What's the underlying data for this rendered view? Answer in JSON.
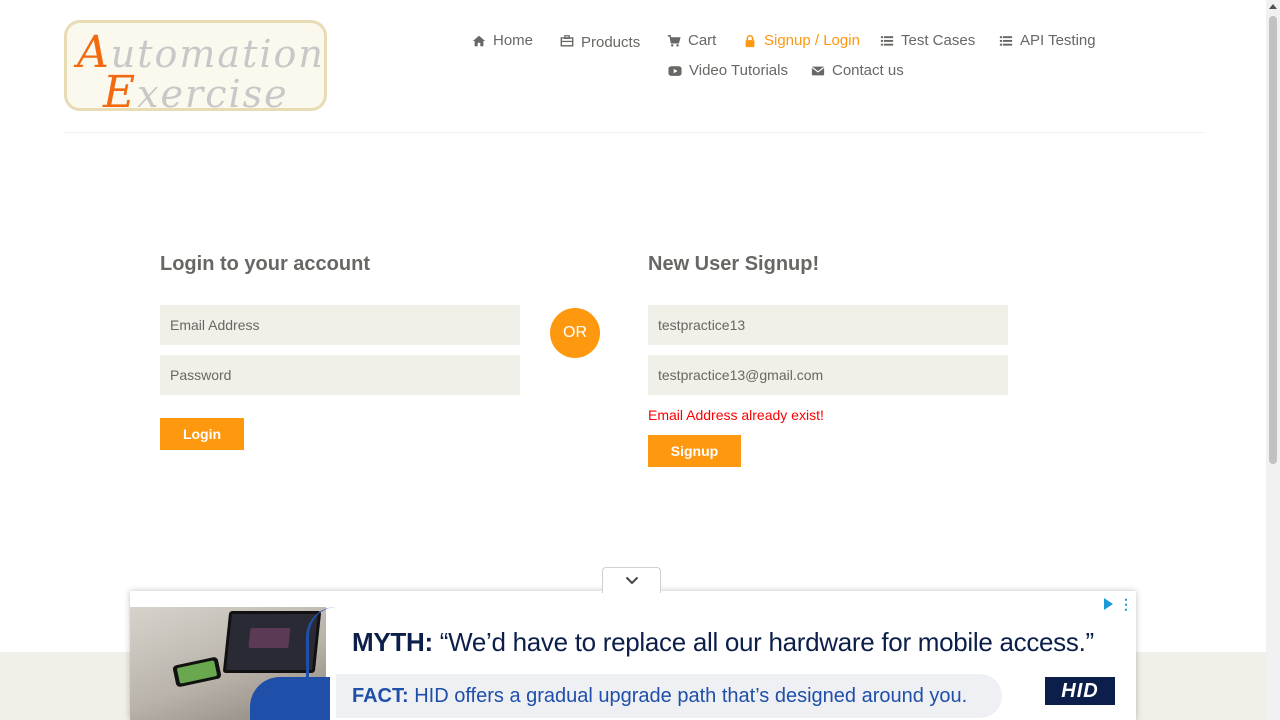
{
  "logo": {
    "line1_cap": "A",
    "line1_rest": "utomation",
    "line2_cap": "E",
    "line2_rest": "xercise"
  },
  "nav": {
    "items": [
      {
        "label": "Home",
        "icon": "home-icon"
      },
      {
        "label": "Products",
        "icon": "products-icon"
      },
      {
        "label": "Cart",
        "icon": "cart-icon"
      },
      {
        "label": "Signup / Login",
        "icon": "lock-icon",
        "active": true
      },
      {
        "label": "Test Cases",
        "icon": "list-icon"
      },
      {
        "label": "API Testing",
        "icon": "list-icon"
      },
      {
        "label": "Video Tutorials",
        "icon": "youtube-icon"
      },
      {
        "label": "Contact us",
        "icon": "envelope-icon"
      }
    ]
  },
  "login": {
    "title": "Login to your account",
    "email_placeholder": "Email Address",
    "password_placeholder": "Password",
    "button": "Login"
  },
  "divider": {
    "label": "OR"
  },
  "signup": {
    "title": "New User Signup!",
    "name_value": "testpractice13",
    "email_value": "testpractice13@gmail.com",
    "error": "Email Address already exist!",
    "button": "Signup"
  },
  "ad": {
    "myth_label": "MYTH:",
    "myth_text": "“We’d have to replace all our hardware for mobile access.”",
    "fact_label": "FACT:",
    "fact_text": "HID offers a gradual upgrade path that’s designed around you.",
    "brand": "HID"
  },
  "colors": {
    "accent": "#fe980f",
    "text": "#696763",
    "field_bg": "#f0f0e9",
    "error": "#ff0000"
  }
}
